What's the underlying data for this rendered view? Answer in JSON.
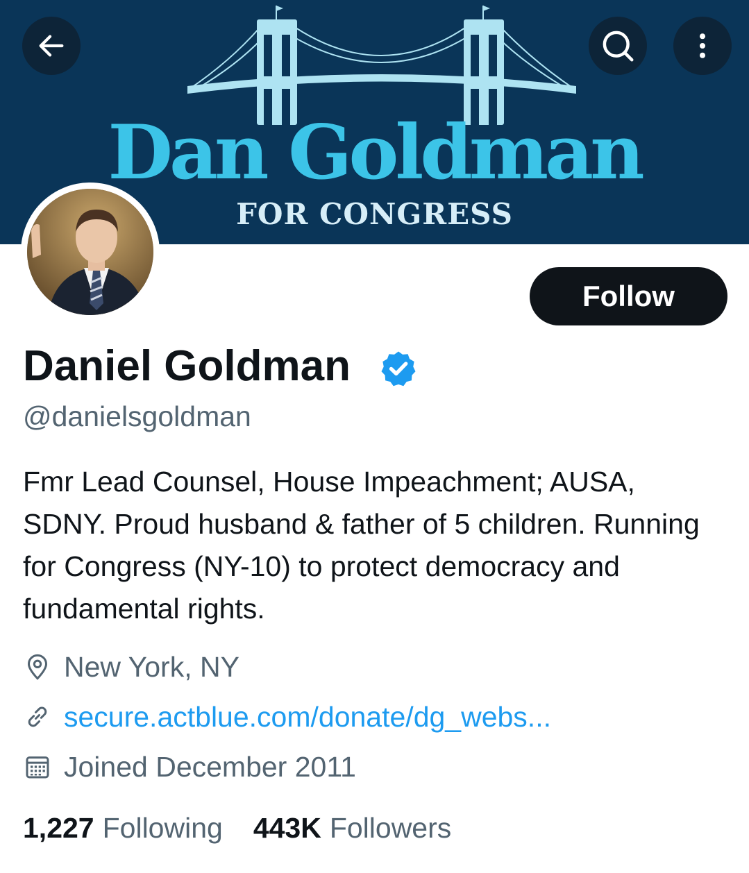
{
  "banner": {
    "title": "Dan Goldman",
    "subtitle": "FOR CONGRESS",
    "background_color": "#0a3558",
    "title_color": "#3cc4e8"
  },
  "topbar": {
    "back_icon": "arrow-left-icon",
    "search_icon": "search-icon",
    "more_icon": "more-vertical-icon"
  },
  "profile": {
    "name": "Daniel Goldman",
    "verified_icon": "verified-badge-icon",
    "handle": "@danielsgoldman",
    "follow_label": "Follow",
    "bio": "Fmr Lead Counsel, House Impeachment; AUSA, SDNY. Proud husband & father of 5 children. Running for Congress (NY-10) to protect democracy and fundamental rights.",
    "location": "New York, NY",
    "website": "secure.actblue.com/donate/dg_webs...",
    "joined": "Joined December 2011"
  },
  "stats": {
    "following_count": "1,227",
    "following_label": "Following",
    "followers_count": "443K",
    "followers_label": "Followers"
  },
  "colors": {
    "accent": "#1d9bf0",
    "text_primary": "#0f1419",
    "text_secondary": "#536471"
  }
}
